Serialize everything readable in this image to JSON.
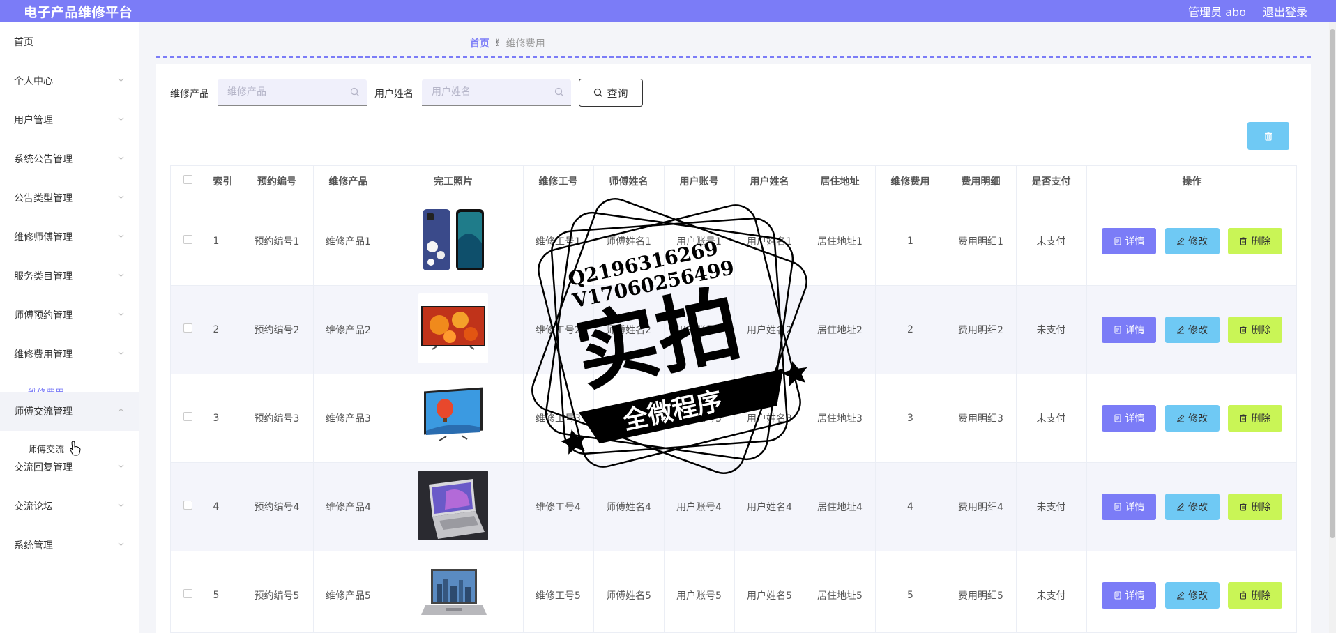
{
  "header": {
    "app_title": "电子产品维修平台",
    "user": "管理员 abo",
    "logout": "退出登录"
  },
  "sidebar": {
    "items": [
      {
        "label": "首页"
      },
      {
        "label": "个人中心"
      },
      {
        "label": "用户管理"
      },
      {
        "label": "系统公告管理"
      },
      {
        "label": "公告类型管理"
      },
      {
        "label": "维修师傅管理"
      },
      {
        "label": "服务类目管理"
      },
      {
        "label": "师傅预约管理"
      },
      {
        "label": "维修费用管理"
      },
      {
        "label": "师傅交流管理"
      },
      {
        "label": "交流回复管理"
      },
      {
        "label": "交流论坛"
      },
      {
        "label": "系统管理"
      }
    ],
    "sub_fee": "维修费用",
    "sub_chat": "师傅交流"
  },
  "breadcrumb": {
    "home": "首页",
    "sep": "✌",
    "current": "维修费用"
  },
  "search": {
    "product_label": "维修产品",
    "product_placeholder": "维修产品",
    "username_label": "用户姓名",
    "username_placeholder": "用户姓名",
    "query_button": "查询"
  },
  "table": {
    "headers": {
      "index": "索引",
      "booking_no": "预约编号",
      "product": "维修产品",
      "photo": "完工照片",
      "worker_no": "维修工号",
      "worker_name": "师傅姓名",
      "account": "用户账号",
      "user_name": "用户姓名",
      "address": "居住地址",
      "fee": "维修费用",
      "fee_detail": "费用明细",
      "paid": "是否支付",
      "actions": "操作"
    },
    "actions": {
      "detail": "详情",
      "edit": "修改",
      "delete": "删除"
    },
    "rows": [
      {
        "index": "1",
        "booking_no": "预约编号1",
        "product": "维修产品1",
        "photo": "phone",
        "worker_no": "维修工号1",
        "worker_name": "师傅姓名1",
        "account": "用户账号1",
        "user_name": "用户姓名1",
        "address": "居住地址1",
        "fee": "1",
        "fee_detail": "费用明细1",
        "paid": "未支付"
      },
      {
        "index": "2",
        "booking_no": "预约编号2",
        "product": "维修产品2",
        "photo": "tv-flowers",
        "worker_no": "维修工号2",
        "worker_name": "师傅姓名2",
        "account": "用户账号2",
        "user_name": "用户姓名2",
        "address": "居住地址2",
        "fee": "2",
        "fee_detail": "费用明细2",
        "paid": "未支付"
      },
      {
        "index": "3",
        "booking_no": "预约编号3",
        "product": "维修产品3",
        "photo": "tv-balloon",
        "worker_no": "维修工号3",
        "worker_name": "师傅姓名3",
        "account": "用户账号3",
        "user_name": "用户姓名3",
        "address": "居住地址3",
        "fee": "3",
        "fee_detail": "费用明细3",
        "paid": "未支付"
      },
      {
        "index": "4",
        "booking_no": "预约编号4",
        "product": "维修产品4",
        "photo": "laptop-silver",
        "worker_no": "维修工号4",
        "worker_name": "师傅姓名4",
        "account": "用户账号4",
        "user_name": "用户姓名4",
        "address": "居住地址4",
        "fee": "4",
        "fee_detail": "费用明细4",
        "paid": "未支付"
      },
      {
        "index": "5",
        "booking_no": "预约编号5",
        "product": "维修产品5",
        "photo": "laptop-city",
        "worker_no": "维修工号5",
        "worker_name": "师傅姓名5",
        "account": "用户账号5",
        "user_name": "用户姓名5",
        "address": "居住地址5",
        "fee": "5",
        "fee_detail": "费用明细5",
        "paid": "未支付"
      }
    ]
  },
  "watermark": {
    "line1": "Q2196316269",
    "line2": "V17060256499",
    "big": "实拍",
    "banner": "全微程序"
  },
  "colors": {
    "primary": "#7b7cf7",
    "info": "#6fc9f4",
    "lime": "#c9f556"
  }
}
